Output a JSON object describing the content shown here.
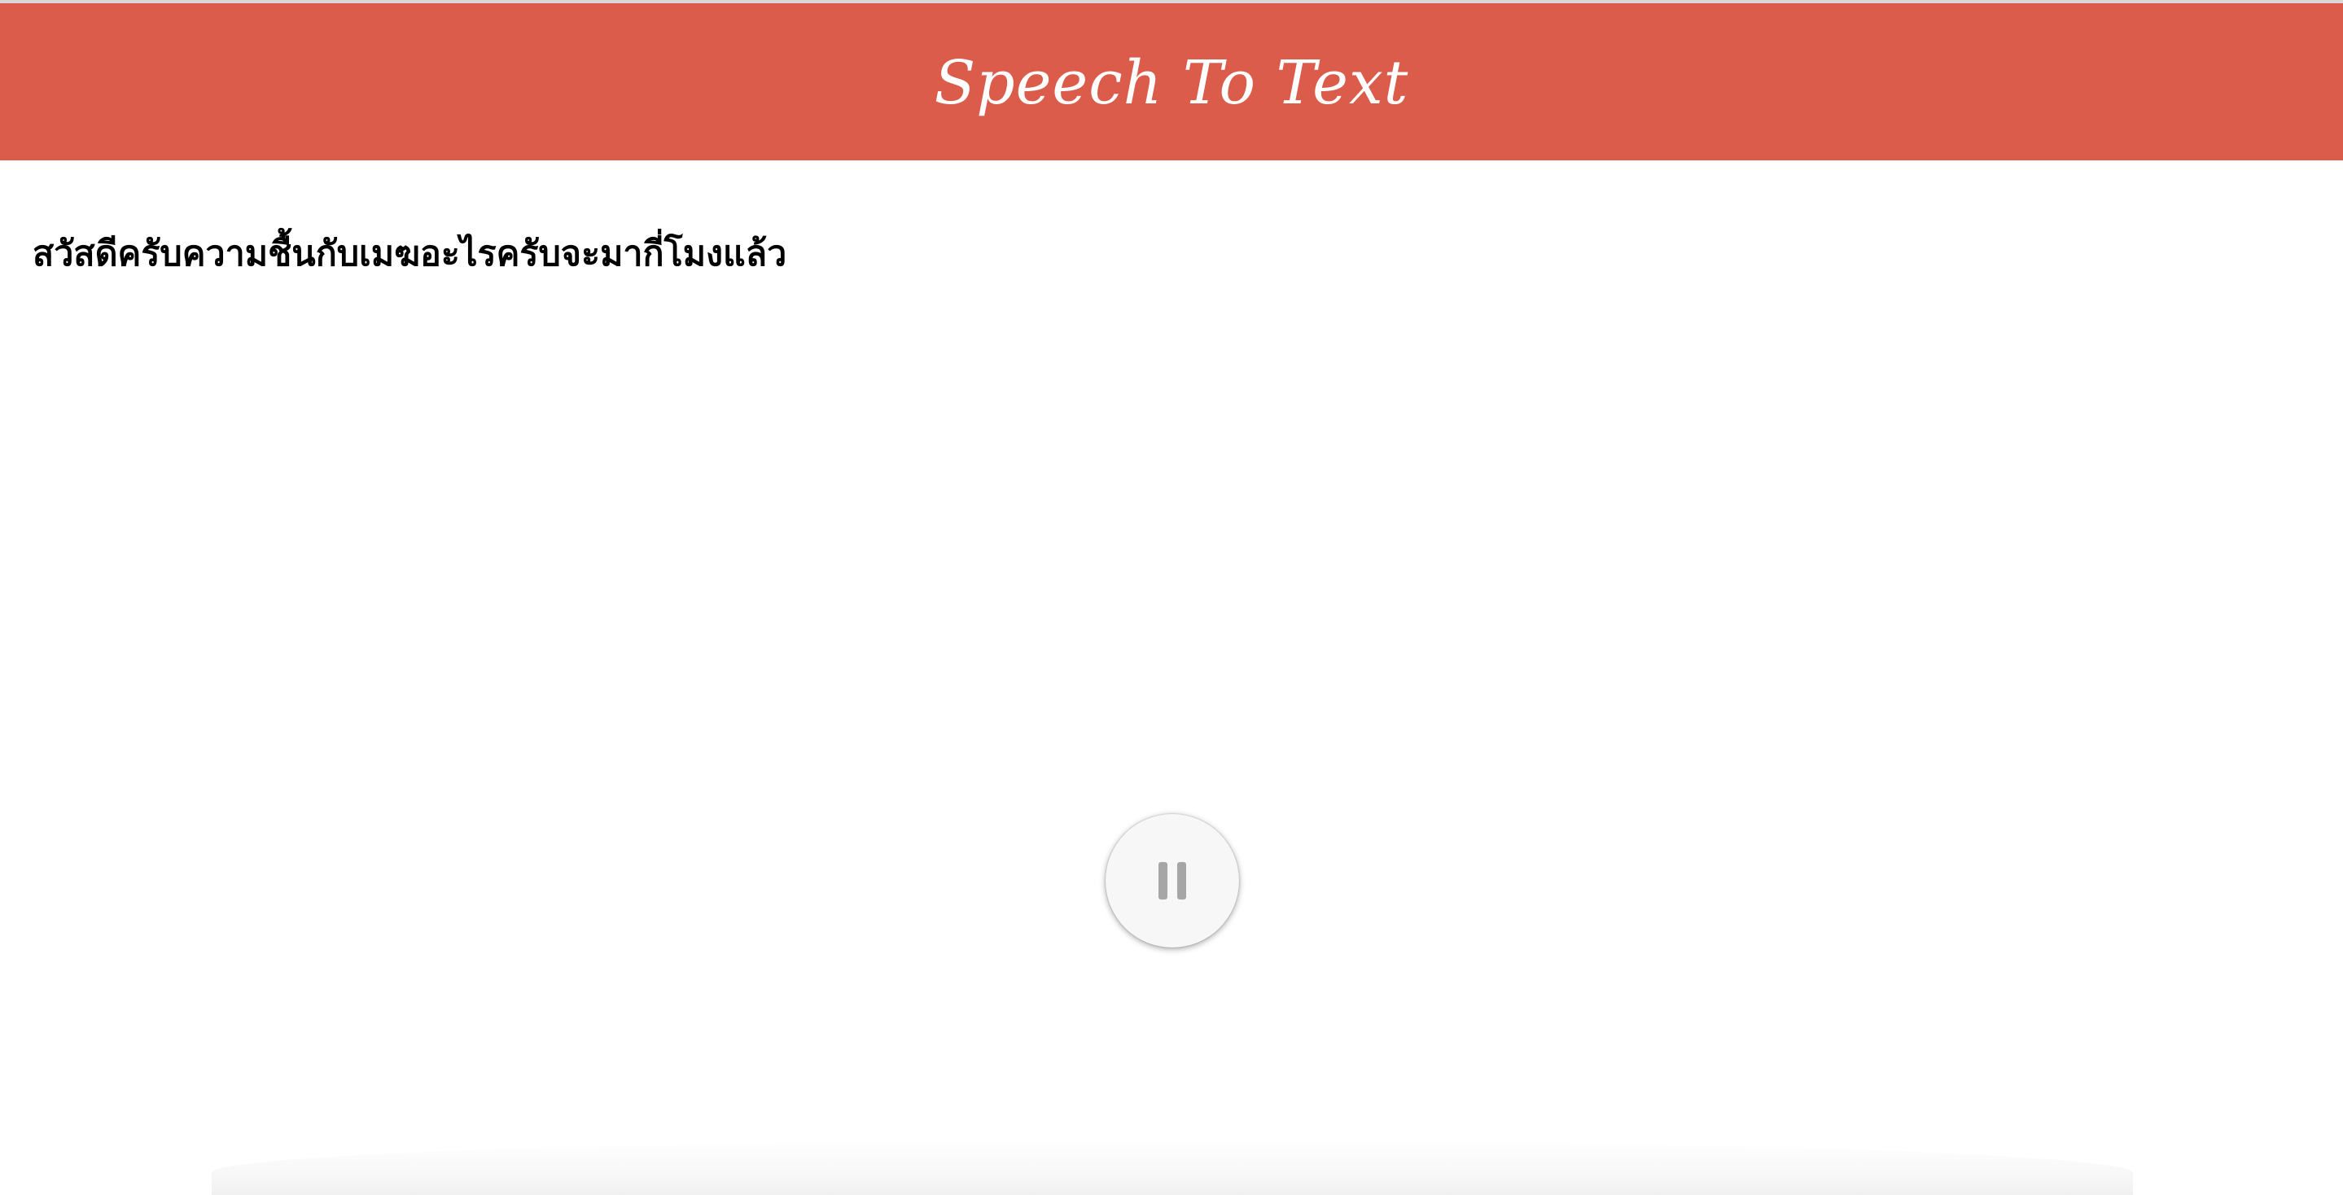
{
  "header": {
    "title": "Speech To Text"
  },
  "transcript": {
    "text": "สวัสดีครับความชื้นกับเมฆอะไรครับจะมากี่โมงแล้ว"
  },
  "controls": {
    "pause_icon": "pause-icon"
  },
  "colors": {
    "header_background": "#db5c4b",
    "header_text": "#ffffff",
    "icon": "#a6a6a6"
  }
}
